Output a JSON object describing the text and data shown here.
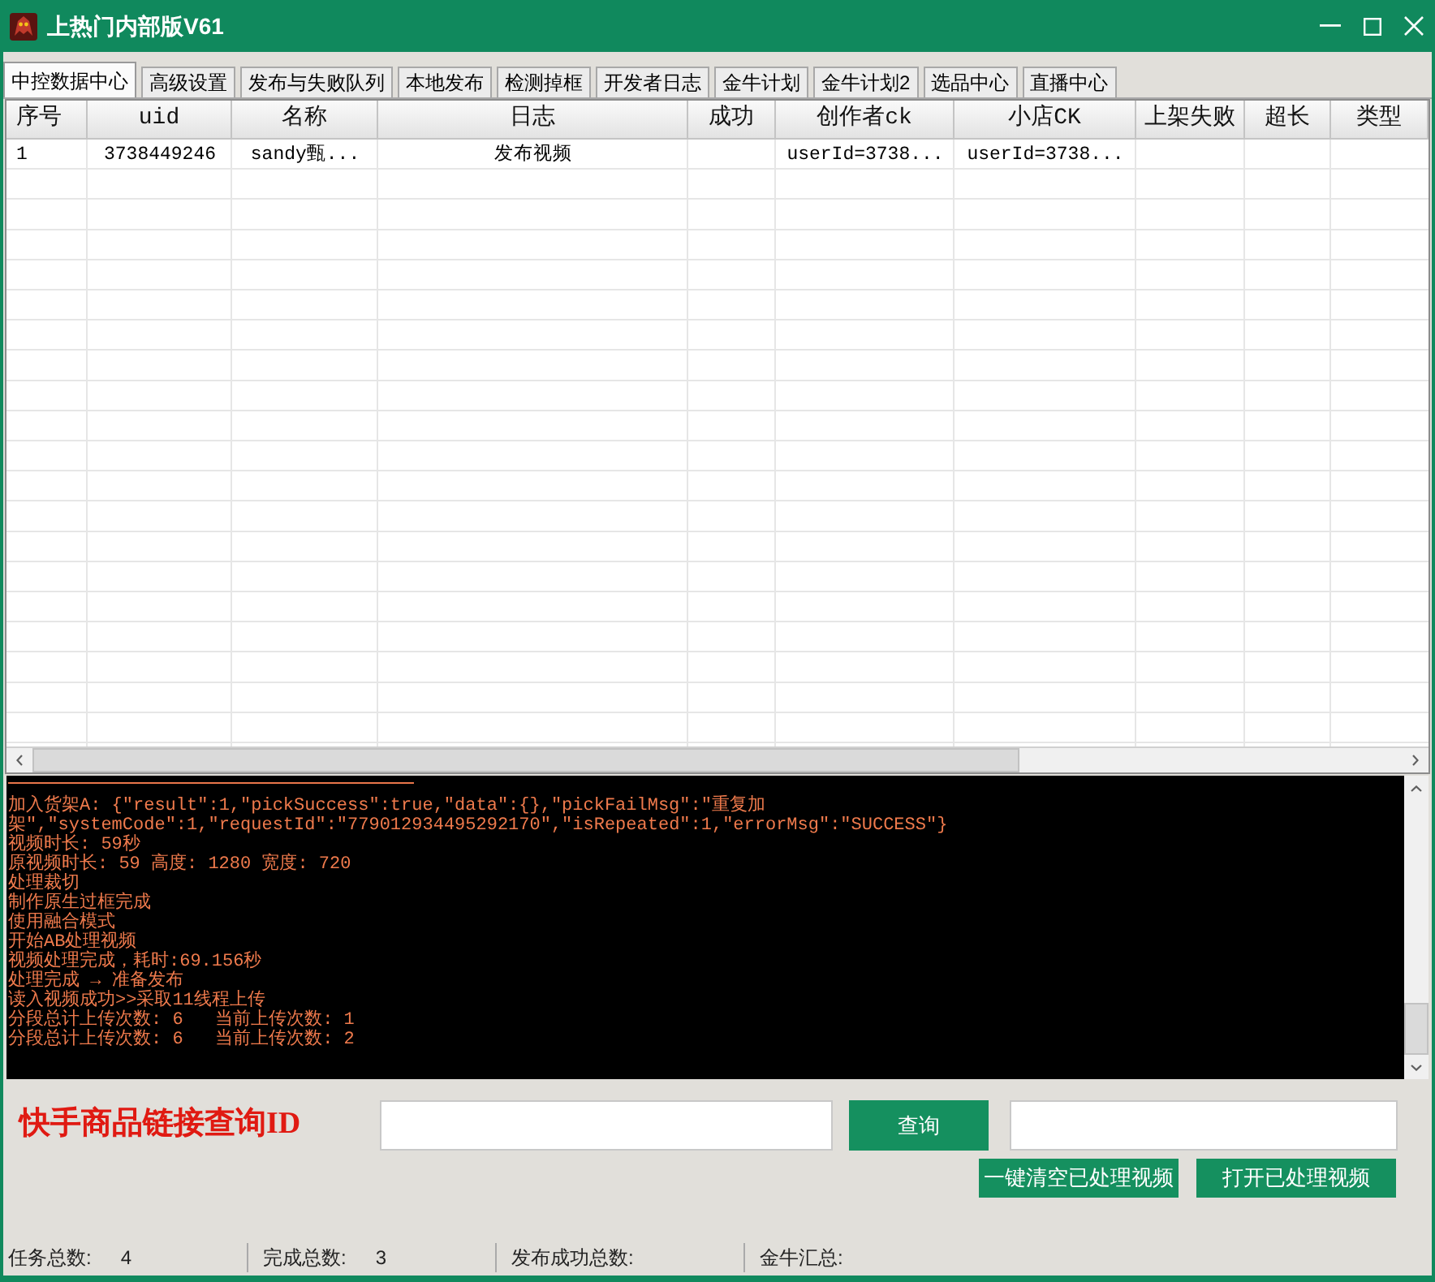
{
  "window": {
    "title": "上热门内部版V61"
  },
  "tabs": [
    {
      "label": "中控数据中心",
      "selected": true
    },
    {
      "label": "高级设置",
      "selected": false
    },
    {
      "label": "发布与失败队列",
      "selected": false
    },
    {
      "label": "本地发布",
      "selected": false
    },
    {
      "label": "检测掉框",
      "selected": false
    },
    {
      "label": "开发者日志",
      "selected": false
    },
    {
      "label": "金牛计划",
      "selected": false
    },
    {
      "label": "金牛计划2",
      "selected": false
    },
    {
      "label": "选品中心",
      "selected": false
    },
    {
      "label": "直播中心",
      "selected": false
    }
  ],
  "table": {
    "columns": [
      "序号",
      "uid",
      "名称",
      "日志",
      "成功",
      "创作者ck",
      "小店CK",
      "上架失败",
      "超长",
      "类型"
    ],
    "rows": [
      [
        "1",
        "3738449246",
        "sandy甄...",
        "发布视频",
        null,
        "userId=3738...",
        "userId=3738...",
        null,
        null,
        null
      ]
    ]
  },
  "log": {
    "lines": [
      "加入货架A: {\"result\":1,\"pickSuccess\":true,\"data\":{},\"pickFailMsg\":\"重复加",
      "架\",\"systemCode\":1,\"requestId\":\"779012934495292170\",\"isRepeated\":1,\"errorMsg\":\"SUCCESS\"}",
      "视频时长: 59秒",
      "原视频时长: 59 高度: 1280 宽度: 720",
      "处理裁切",
      "制作原生过框完成",
      "使用融合模式",
      "开始AB处理视频",
      "视频处理完成，耗时:69.156秒",
      "处理完成 → 准备发布",
      "读入视频成功>>采取11线程上传",
      "分段总计上传次数: 6   当前上传次数: 1",
      "分段总计上传次数: 6   当前上传次数: 2"
    ]
  },
  "query": {
    "label": "快手商品链接查询ID",
    "button": "查询"
  },
  "actions": [
    "一键清空已处理视频",
    "打开已处理视频"
  ],
  "status_bar": [
    {
      "label": "任务总数:",
      "value": "4"
    },
    {
      "label": "完成总数:",
      "value": "3"
    },
    {
      "label": "发布成功总数:"
    },
    {
      "label": "金牛汇总:"
    }
  ]
}
